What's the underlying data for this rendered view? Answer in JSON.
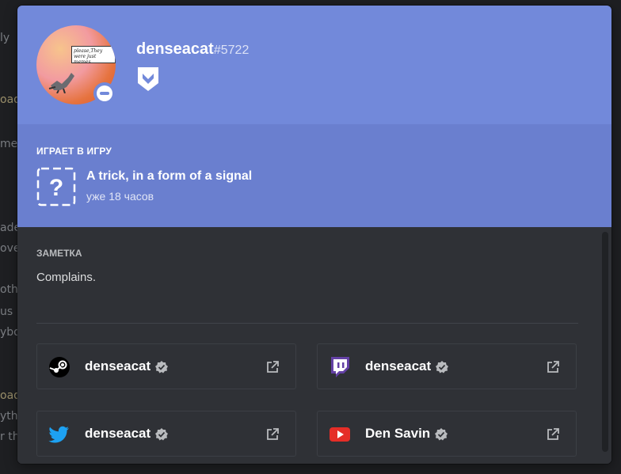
{
  "background": {
    "lines": [
      {
        "text": "ly",
        "muted": true
      },
      {
        "text": "oad",
        "muted": false
      },
      {
        "text": "me",
        "muted": true
      },
      {
        "text": "ade",
        "muted": true
      },
      {
        "text": "ove",
        "muted": true
      },
      {
        "text": "oth",
        "muted": true
      },
      {
        "text": "us",
        "muted": true
      },
      {
        "text": "ybo",
        "muted": true
      },
      {
        "text": "oad",
        "muted": false
      },
      {
        "text": "yth",
        "muted": true
      },
      {
        "text": "r th",
        "muted": true
      }
    ]
  },
  "profile": {
    "username": "denseacat",
    "discriminator": "#5722",
    "avatar_caption": "please,They were just memes",
    "status": "dnd",
    "badge": "hypesquad-badge-icon",
    "header_color": "#7289da"
  },
  "activity": {
    "title": "ИГРАЕТ В ИГРУ",
    "game_name": "A trick, in a form of a signal",
    "elapsed": "уже 18 часов",
    "background_color": "#6a7fcf"
  },
  "note": {
    "title": "ЗАМЕТКА",
    "text": "Complains."
  },
  "connected_accounts": [
    {
      "service": "steam",
      "icon": "steam-icon",
      "name": "denseacat",
      "verified": true
    },
    {
      "service": "twitch",
      "icon": "twitch-icon",
      "name": "denseacat",
      "verified": true
    },
    {
      "service": "twitter",
      "icon": "twitter-icon",
      "name": "denseacat",
      "verified": true
    },
    {
      "service": "youtube",
      "icon": "youtube-icon",
      "name": "Den Savin",
      "verified": true
    }
  ]
}
